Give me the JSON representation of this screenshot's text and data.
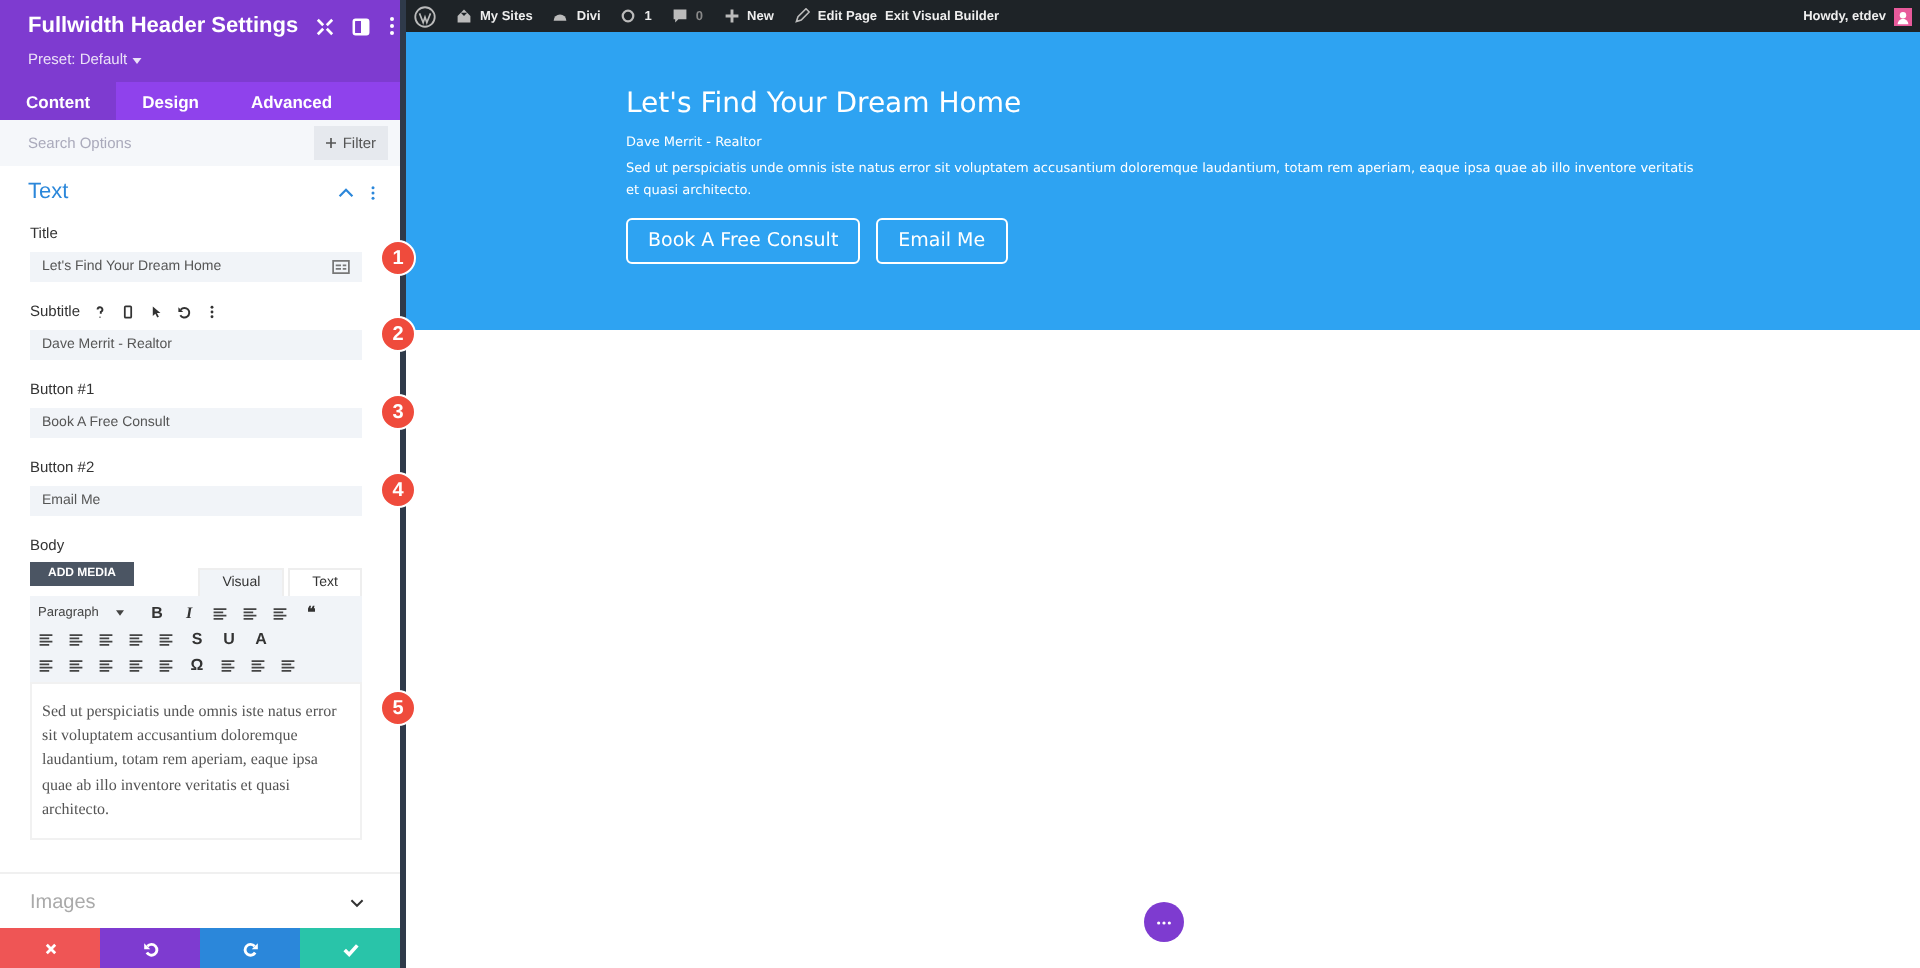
{
  "panel": {
    "title": "Fullwidth Header Settings",
    "preset": "Preset: Default",
    "tabs": [
      {
        "label": "Content",
        "selected": true
      },
      {
        "label": "Design",
        "selected": false
      },
      {
        "label": "Advanced",
        "selected": false
      }
    ],
    "search": {
      "placeholder": "Search Options"
    },
    "filter": "Filter",
    "section": {
      "title": "Text",
      "expanded": true
    },
    "fields": [
      {
        "label": "Title",
        "value": "Let's Find Your Dream Home",
        "kind": "title"
      },
      {
        "label": "Subtitle",
        "value": "Dave Merrit - Realtor",
        "kind": "hover"
      },
      {
        "label": "Button #1",
        "value": "Book A Free Consult",
        "kind": "text"
      },
      {
        "label": "Button #2",
        "value": "Email Me",
        "kind": "text"
      }
    ],
    "body": {
      "label": "Body",
      "add_media": "ADD MEDIA",
      "editor_tabs": [
        {
          "label": "Visual",
          "selected": true
        },
        {
          "label": "Text",
          "selected": false
        }
      ],
      "toolbar": [
        [
          {
            "kind": "select",
            "text": "Paragraph"
          },
          {
            "kind": "glyph",
            "text": "B"
          },
          {
            "kind": "glyph",
            "text": "I",
            "italic": true
          },
          {
            "kind": "icon"
          },
          {
            "kind": "icon"
          },
          {
            "kind": "icon"
          },
          {
            "kind": "glyph",
            "text": "❝"
          }
        ],
        [
          {
            "kind": "icon"
          },
          {
            "kind": "icon"
          },
          {
            "kind": "icon"
          },
          {
            "kind": "icon"
          },
          {
            "kind": "icon"
          },
          {
            "kind": "glyph",
            "text": "S"
          },
          {
            "kind": "glyph",
            "text": "U"
          },
          {
            "kind": "glyph",
            "text": "A"
          }
        ],
        [
          {
            "kind": "icon"
          },
          {
            "kind": "icon"
          },
          {
            "kind": "icon"
          },
          {
            "kind": "icon"
          },
          {
            "kind": "icon"
          },
          {
            "kind": "glyph",
            "text": "Ω"
          },
          {
            "kind": "icon"
          },
          {
            "kind": "icon"
          },
          {
            "kind": "icon"
          }
        ]
      ],
      "content": "Sed ut perspiciatis unde omnis iste natus error sit voluptatem accusantium doloremque laudantium, totam rem aperiam, eaque ipsa quae ab illo inventore veritatis et quasi architecto."
    },
    "collapsed": {
      "title": "Images",
      "expanded": false
    }
  },
  "markers": [
    "1",
    "2",
    "3",
    "4",
    "5"
  ],
  "admin_bar": {
    "items": [
      "My Sites",
      "Divi",
      "1",
      "0",
      "New",
      "Edit Page",
      "Exit Visual Builder"
    ],
    "greeting": "Howdy, etdev"
  },
  "hero": {
    "title": "Let's Find Your Dream Home",
    "subtitle": "Dave Merrit - Realtor",
    "body": "Sed ut perspiciatis unde omnis iste natus error sit voluptatem accusantium doloremque laudantium, totam rem aperiam, eaque ipsa quae ab illo inventore veritatis et quasi architecto.",
    "buttons": [
      "Book A Free Consult",
      "Email Me"
    ]
  }
}
